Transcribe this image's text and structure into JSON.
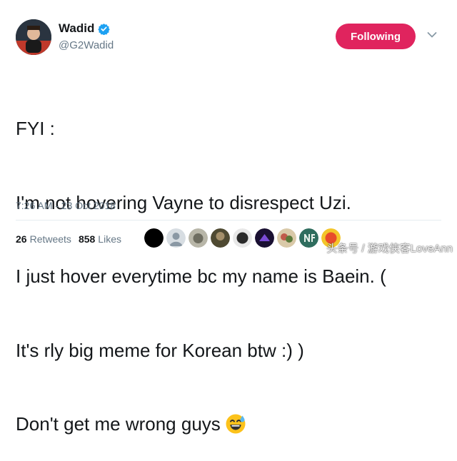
{
  "user": {
    "display_name": "Wadid",
    "handle": "@G2Wadid"
  },
  "follow_button": {
    "label": "Following",
    "color": "#e0245e"
  },
  "tweet": {
    "lines": [
      "FYI :",
      "I'm not hovering Vayne to disrespect Uzi.",
      "I just hover everytime bc my name is Baein. (",
      "It's rly big meme for Korean btw :) )",
      "Don't get me wrong guys"
    ],
    "emoji": "sweat-smile-emoji",
    "timestamp": "7:26 AM - 23 Oct 2018"
  },
  "stats": {
    "retweets_count": "26",
    "retweets_label": "Retweets",
    "likes_count": "858",
    "likes_label": "Likes"
  },
  "liker_colors": [
    "#000000",
    "#9aa5ad",
    "#7d7d6e",
    "#6b6b4a",
    "#2a2a2a",
    "#3b1f6b",
    "#c05a4a",
    "#2f6d5e",
    "#e84b2b"
  ],
  "watermark": "头条号 / 游戏侠客LoveAnn"
}
